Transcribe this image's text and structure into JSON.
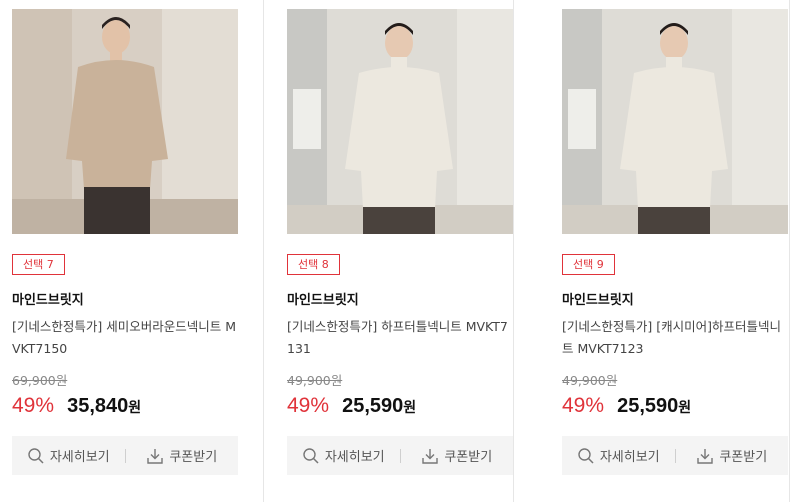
{
  "products": [
    {
      "badge": "선택 7",
      "brand": "마인드브릿지",
      "name": "[기네스한정특가] 세미오버라운드넥니트 MVKT7150",
      "original_price": "69,900원",
      "discount": "49%",
      "price": "35,840",
      "price_unit": "원",
      "sweater_color": "#c9b29a"
    },
    {
      "badge": "선택 8",
      "brand": "마인드브릿지",
      "name": "[기네스한정특가] 하프터틀넥니트 MVKT7131",
      "original_price": "49,900원",
      "discount": "49%",
      "price": "25,590",
      "price_unit": "원",
      "sweater_color": "#ece8df"
    },
    {
      "badge": "선택 9",
      "brand": "마인드브릿지",
      "name": "[기네스한정특가] [캐시미어]하프터틀넥니트 MVKT7123",
      "original_price": "49,900원",
      "discount": "49%",
      "price": "25,590",
      "price_unit": "원",
      "sweater_color": "#ece8df"
    }
  ],
  "actions": {
    "detail_label": "자세히보기",
    "coupon_label": "쿠폰받기"
  },
  "colors": {
    "accent": "#e0333a",
    "action_bg": "#f4f4f4"
  }
}
